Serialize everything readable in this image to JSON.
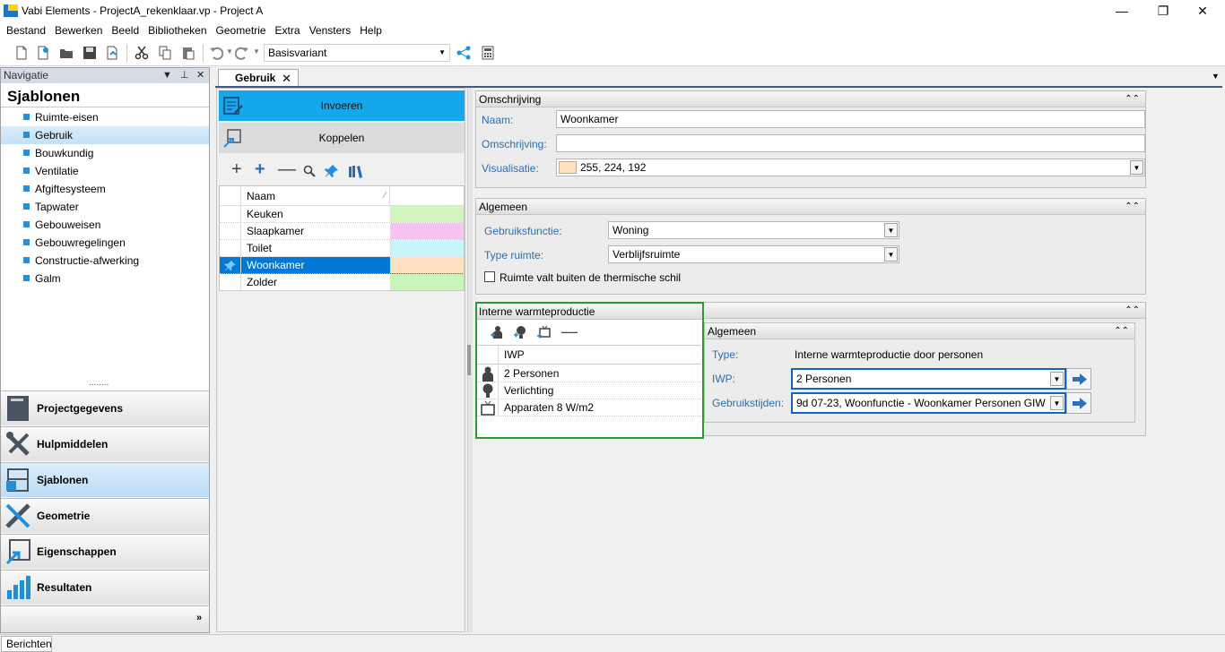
{
  "window": {
    "title": "Vabi Elements - ProjectA_rekenklaar.vp - Project A",
    "minimize": "—",
    "maximize": "❐",
    "close": "✕"
  },
  "menu": [
    "Bestand",
    "Bewerken",
    "Beeld",
    "Bibliotheken",
    "Geometrie",
    "Extra",
    "Vensters",
    "Help"
  ],
  "toolbar": {
    "variant": "Basisvariant"
  },
  "navigation": {
    "header": "Navigatie",
    "title": "Sjablonen",
    "items": [
      "Ruimte-eisen",
      "Gebruik",
      "Bouwkundig",
      "Ventilatie",
      "Afgiftesysteem",
      "Tapwater",
      "Gebouweisen",
      "Gebouwregelingen",
      "Constructie-afwerking",
      "Galm"
    ],
    "selected_item": "Gebruik",
    "sections": [
      "Projectgegevens",
      "Hulpmiddelen",
      "Sjablonen",
      "Geometrie",
      "Eigenschappen",
      "Resultaten"
    ],
    "selected_section": "Sjablonen",
    "grip": "........"
  },
  "document_tab": {
    "label": "Gebruik"
  },
  "list_panel": {
    "btn_invoeren": "Invoeren",
    "btn_koppelen": "Koppelen",
    "column_naam": "Naam",
    "rows": [
      {
        "name": "Keuken",
        "color": "#d2f5c0"
      },
      {
        "name": "Slaapkamer",
        "color": "#f7c3f0"
      },
      {
        "name": "Toilet",
        "color": "#c7f6f8"
      },
      {
        "name": "Woonkamer",
        "color": "#ffe0c0"
      },
      {
        "name": "Zolder",
        "color": "#c8f5b8"
      }
    ],
    "selected_row": "Woonkamer"
  },
  "omschrijving_panel": {
    "title": "Omschrijving",
    "naam_label": "Naam:",
    "naam_value": "Woonkamer",
    "omschrijving_label": "Omschrijving:",
    "omschrijving_value": "",
    "visualisatie_label": "Visualisatie:",
    "visualisatie_value": "255, 224, 192",
    "visualisatie_color": "#ffe0c0"
  },
  "algemeen_panel": {
    "title": "Algemeen",
    "gebruiksfunctie_label": "Gebruiksfunctie:",
    "gebruiksfunctie_value": "Woning",
    "type_ruimte_label": "Type ruimte:",
    "type_ruimte_value": "Verblijfsruimte",
    "checkbox_label": "Ruimte valt buiten de thermische schil",
    "checkbox_checked": false
  },
  "iwp_panel": {
    "title": "Interne warmteproductie",
    "column": "IWP",
    "rows": [
      {
        "name": "2 Personen",
        "icon": "person-icon"
      },
      {
        "name": "Verlichting",
        "icon": "bulb-icon"
      },
      {
        "name": "Apparaten 8 W/m2",
        "icon": "tv-icon"
      }
    ],
    "detail": {
      "title": "Algemeen",
      "type_label": "Type:",
      "type_value": "Interne warmteproductie door personen",
      "iwp_label": "IWP:",
      "iwp_value": "2 Personen",
      "gebruikstijden_label": "Gebruikstijden:",
      "gebruikstijden_value": "9d 07-23, Woonfunctie - Woonkamer Personen GIW"
    }
  },
  "statusbar": {
    "tab": "Berichten"
  },
  "colors": {
    "accent": "#14a7ec",
    "selection": "#0078d7",
    "highlight_border": "#2e9b2e",
    "field_focus": "#1565c0"
  }
}
